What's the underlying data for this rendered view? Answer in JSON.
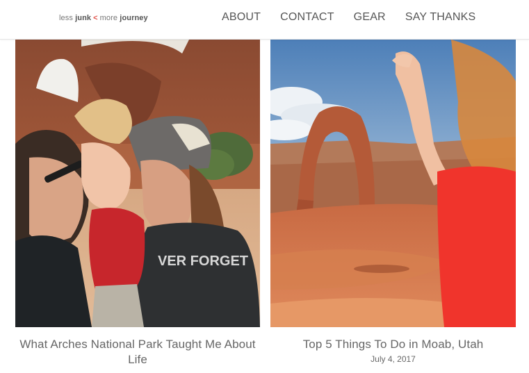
{
  "logo": {
    "part1": "less",
    "part2": "junk",
    "arrow": "<",
    "part3": "more",
    "part4": "journey"
  },
  "nav": [
    {
      "label": "ABOUT"
    },
    {
      "label": "CONTACT"
    },
    {
      "label": "GEAR"
    },
    {
      "label": "SAY THANKS"
    }
  ],
  "posts": [
    {
      "title": "What Arches National Park Taught Me About Life",
      "date": ""
    },
    {
      "title": "Top 5 Things To Do in Moab, Utah",
      "date": "July 4, 2017"
    }
  ],
  "photo_text": {
    "shirt": "VER FORGET"
  }
}
